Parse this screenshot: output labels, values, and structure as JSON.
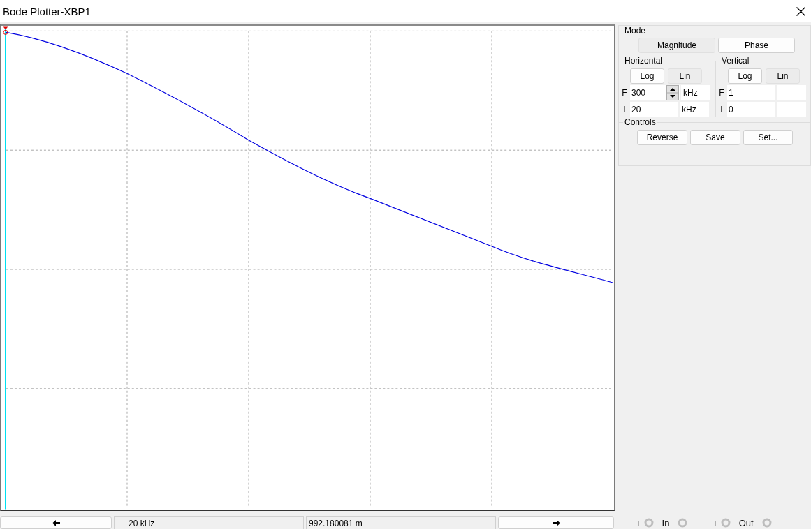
{
  "window": {
    "title": "Bode Plotter-XBP1"
  },
  "mode": {
    "label": "Mode",
    "buttons": [
      {
        "label": "Magnitude",
        "selected": true
      },
      {
        "label": "Phase",
        "selected": false
      }
    ]
  },
  "horizontal": {
    "label": "Horizontal",
    "scale_buttons": [
      {
        "label": "Log",
        "selected": false
      },
      {
        "label": "Lin",
        "selected": true
      }
    ],
    "fields": [
      {
        "prefix": "F",
        "value": "300",
        "unit": "kHz",
        "spinner": true
      },
      {
        "prefix": "I",
        "value": "20",
        "unit": "kHz",
        "spinner": false
      }
    ]
  },
  "vertical": {
    "label": "Vertical",
    "scale_buttons": [
      {
        "label": "Log",
        "selected": false
      },
      {
        "label": "Lin",
        "selected": true
      }
    ],
    "fields": [
      {
        "prefix": "F",
        "value": "1",
        "spinner": false
      },
      {
        "prefix": "I",
        "value": "0",
        "spinner": false
      }
    ]
  },
  "controls": {
    "label": "Controls",
    "buttons": [
      "Reverse",
      "Save",
      "Set..."
    ]
  },
  "readout": {
    "frequency": "20 kHz",
    "value": "992.180081 m"
  },
  "terminals": [
    {
      "plus": "+",
      "label": "In",
      "minus": "−"
    },
    {
      "plus": "+",
      "label": "Out",
      "minus": "−"
    }
  ]
}
